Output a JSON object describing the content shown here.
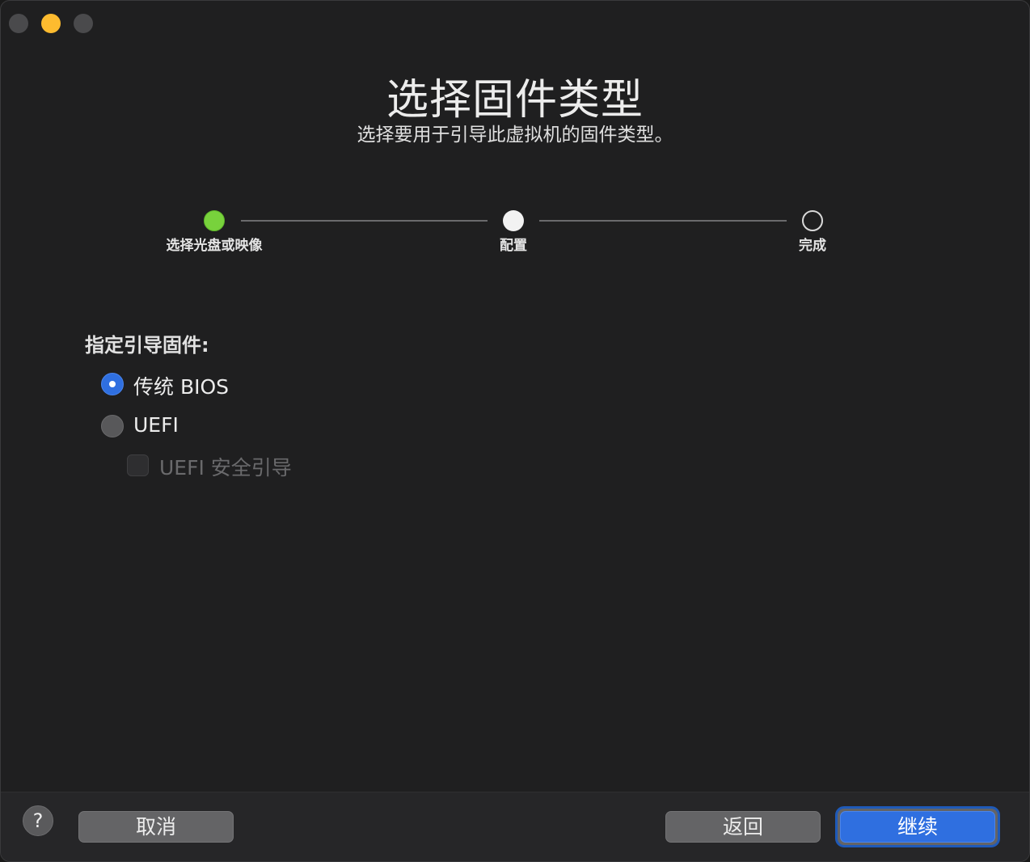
{
  "window": {
    "title": "选择固件类型",
    "subtitle": "选择要用于引导此虚拟机的固件类型。"
  },
  "stepper": {
    "steps": [
      {
        "label": "选择光盘或映像",
        "state": "done"
      },
      {
        "label": "配置",
        "state": "current"
      },
      {
        "label": "完成",
        "state": "pending"
      }
    ],
    "colors": {
      "done": "#78d23c",
      "current": "#f2f2f2"
    }
  },
  "firmware": {
    "label": "指定引导固件:",
    "options": [
      {
        "label": "传统 BIOS",
        "selected": true
      },
      {
        "label": "UEFI",
        "selected": false
      }
    ],
    "secure_boot": {
      "label": "UEFI 安全引导",
      "checked": false,
      "enabled": false
    }
  },
  "footer": {
    "help_label": "?",
    "cancel_label": "取消",
    "back_label": "返回",
    "continue_label": "继续"
  },
  "colors": {
    "accent": "#2f6fe0",
    "background": "#1f1f20"
  }
}
